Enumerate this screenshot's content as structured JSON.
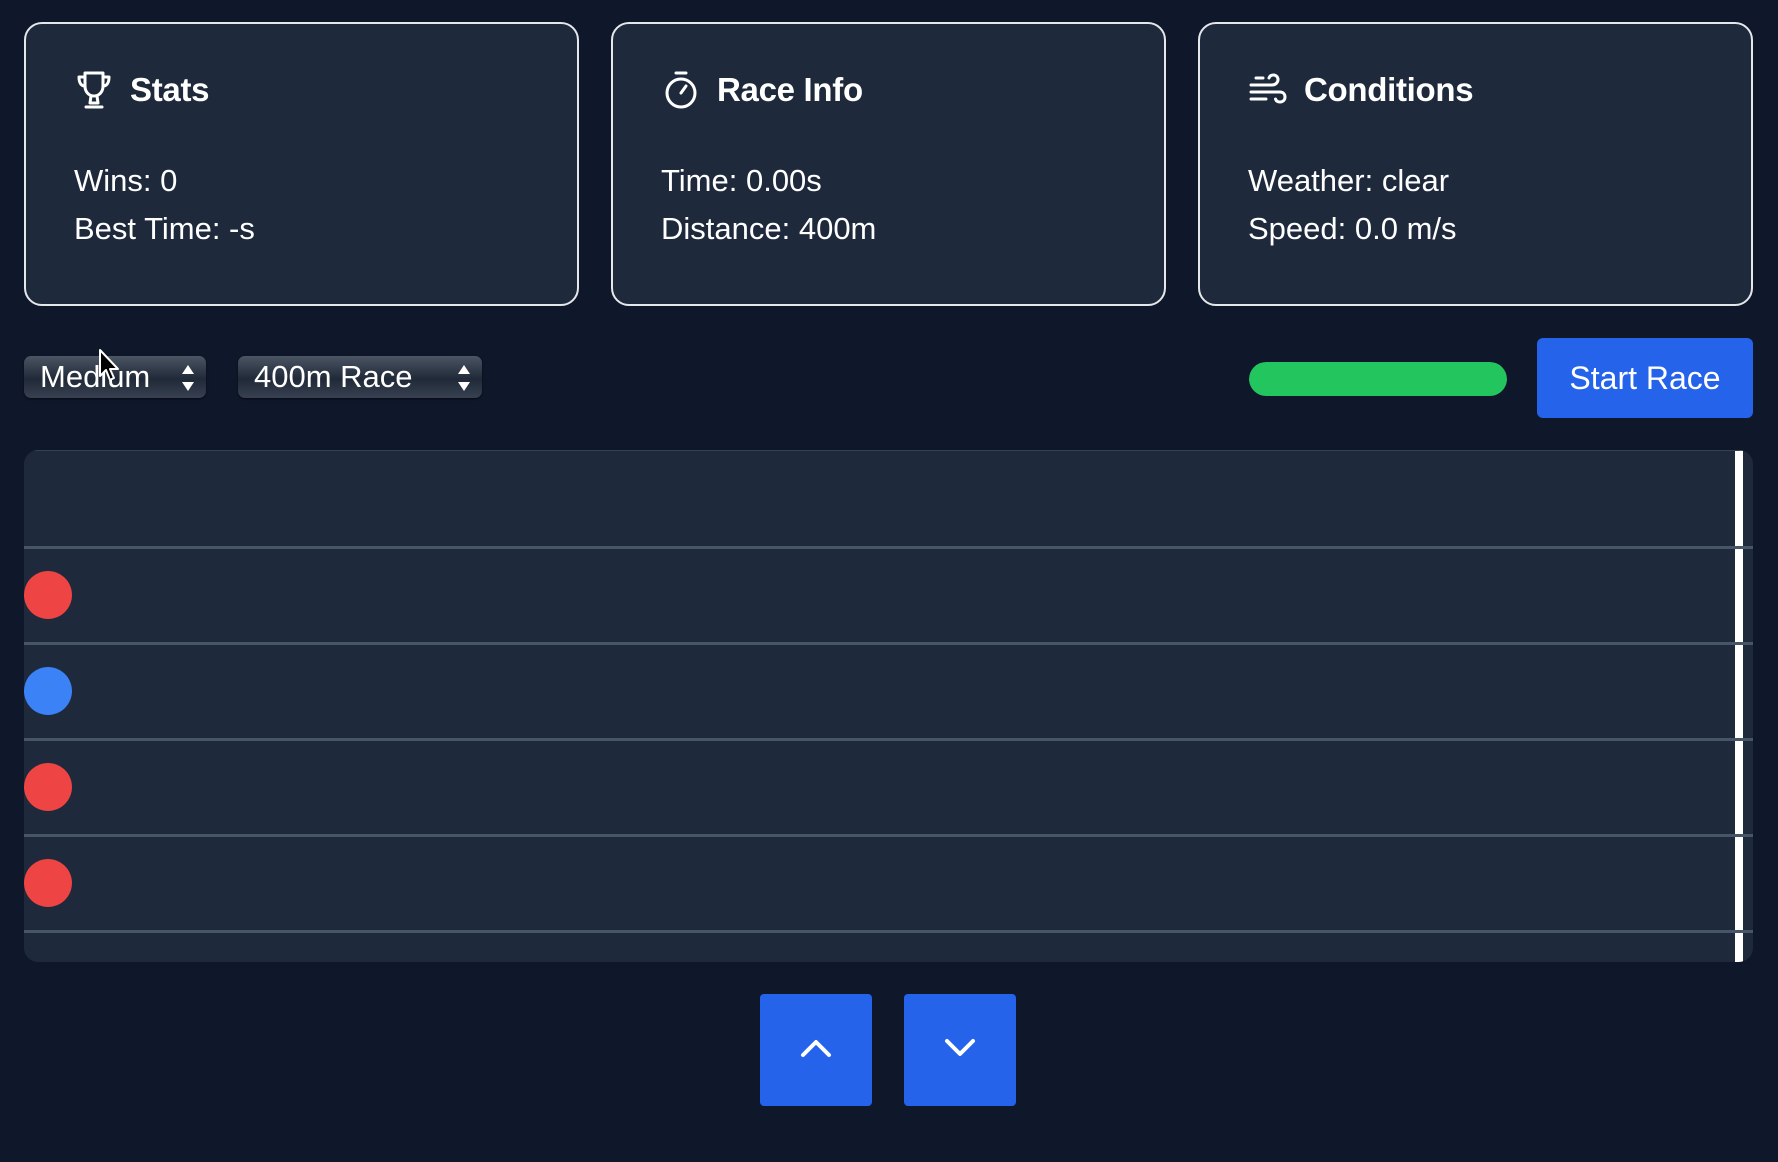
{
  "cards": [
    {
      "icon": "trophy-icon",
      "title": "Stats",
      "lines": [
        "Wins: 0",
        "Best Time: -s"
      ]
    },
    {
      "icon": "stopwatch-icon",
      "title": "Race Info",
      "lines": [
        "Time: 0.00s",
        "Distance: 400m"
      ]
    },
    {
      "icon": "wind-icon",
      "title": "Conditions",
      "lines": [
        "Weather: clear",
        "Speed: 0.0 m/s"
      ]
    }
  ],
  "controls": {
    "difficulty_value": "Medium",
    "race_value": "400m Race",
    "stamina_fraction": 1.0,
    "start_label": "Start Race"
  },
  "track": {
    "lanes": [
      {
        "runner": false,
        "progress": 0
      },
      {
        "runner": true,
        "color": "#ef4444",
        "progress": 0
      },
      {
        "runner": true,
        "color": "#3b82f6",
        "progress": 0
      },
      {
        "runner": true,
        "color": "#ef4444",
        "progress": 0
      },
      {
        "runner": true,
        "color": "#ef4444",
        "progress": 0
      }
    ]
  },
  "nav": {
    "up_icon": "chevron-up-icon",
    "down_icon": "chevron-down-icon"
  },
  "colors": {
    "background": "#0f172a",
    "card": "#1e293b",
    "accent": "#2563eb",
    "stamina": "#22c55e",
    "opponent": "#ef4444",
    "player": "#3b82f6"
  }
}
